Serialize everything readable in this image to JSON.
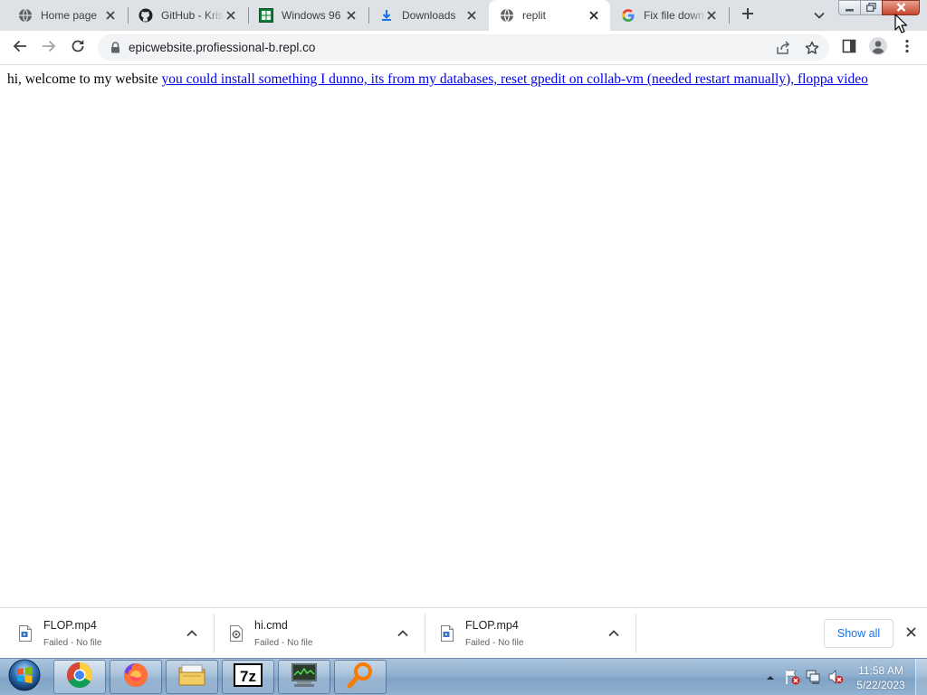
{
  "browser": {
    "tabs": [
      {
        "title": "Home page",
        "favicon": "globe-icon",
        "active": false
      },
      {
        "title": "GitHub - Kris",
        "favicon": "github-icon",
        "active": false
      },
      {
        "title": "Windows 96",
        "favicon": "windows96-icon",
        "active": false
      },
      {
        "title": "Downloads",
        "favicon": "download-icon",
        "active": false
      },
      {
        "title": "replit",
        "favicon": "globe-icon",
        "active": true
      },
      {
        "title": "Fix file down",
        "favicon": "google-icon",
        "active": false
      }
    ],
    "address_bar": {
      "url": "epicwebsite.profiessional-b.repl.co",
      "secure": true
    }
  },
  "page": {
    "greeting": "hi, welcome to my website",
    "link_text": "you could install something I dunno, its from my databases, reset gpedit on collab-vm (needed restart manually), floppa video",
    "link_color": "#0000ee"
  },
  "downloads": {
    "items": [
      {
        "name": "FLOP.mp4",
        "status": "Failed - No file",
        "icon": "video-file-icon"
      },
      {
        "name": "hi.cmd",
        "status": "Failed - No file",
        "icon": "script-file-icon"
      },
      {
        "name": "FLOP.mp4",
        "status": "Failed - No file",
        "icon": "video-file-icon"
      }
    ],
    "show_all_label": "Show all"
  },
  "taskbar": {
    "apps": [
      "chrome-icon",
      "firefox-icon",
      "file-explorer-icon",
      "7zip-icon",
      "task-manager-icon",
      "search-app-icon"
    ],
    "clock": {
      "time": "11:58 AM",
      "date": "5/22/2023"
    }
  },
  "colors": {
    "tabstrip_bg": "#dee1e6",
    "omnibox_bg": "#f1f3f4",
    "accent": "#1a73e8"
  }
}
